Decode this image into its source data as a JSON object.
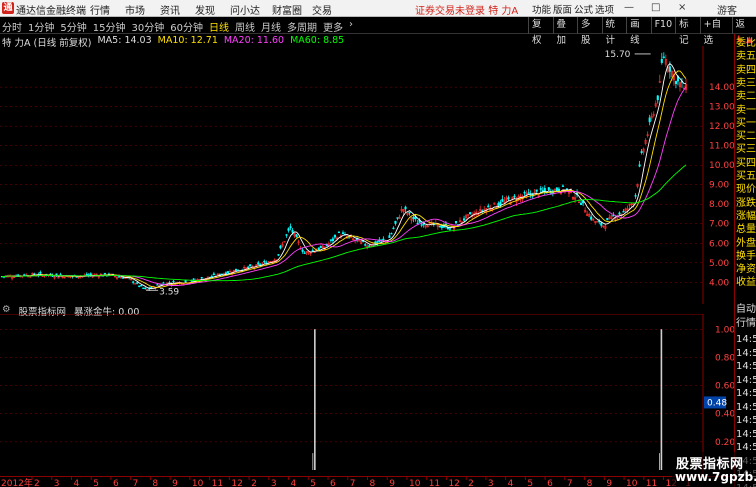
{
  "app": {
    "title": "通达信金融终端",
    "menu": [
      "行情",
      "市场",
      "资讯",
      "发现",
      "问小达",
      "财富圈",
      "交易"
    ],
    "status": "证券交易未登录",
    "stock_name": "特 力A",
    "right_menu": [
      "功能",
      "版面",
      "公式",
      "选项"
    ],
    "guest": "游客",
    "window_buttons": [
      "—",
      "□",
      "×"
    ]
  },
  "toolbar": {
    "periods": [
      "分时",
      "1分钟",
      "5分钟",
      "15分钟",
      "30分钟",
      "60分钟",
      "日线",
      "周线",
      "月线",
      "多周期",
      "更多"
    ],
    "active_period": "日线",
    "more_arrow": "›",
    "tools": [
      "复权",
      "叠加",
      "多股",
      "统计",
      "画线",
      "F10",
      "标记",
      "+自选",
      "返回"
    ]
  },
  "legend": {
    "stock": "特 力A (日线 前复权)",
    "ma5": "MA5: 14.03",
    "ma10": "MA10: 12.71",
    "ma20": "MA20: 11.60",
    "ma60": "MA60: 8.85"
  },
  "colors": {
    "up": "#ff3030",
    "down": "#00ffff",
    "ma5": "#ffffff",
    "ma10": "#ffe000",
    "ma20": "#ff40ff",
    "ma60": "#00ff00",
    "grid": "#8b0000",
    "axis_text": "#ff4040",
    "ind_bar": "#d0d0d0",
    "ind_marker": "#0044aa"
  },
  "chart_data": [
    {
      "type": "candlestick",
      "title": "特 力A (日线 前复权)",
      "y_ticks": [
        14.0,
        13.0,
        12.0,
        11.0,
        10.0,
        9.0,
        8.0,
        7.0,
        6.0,
        5.0,
        4.0
      ],
      "ylim": [
        3.4,
        15.8
      ],
      "annotations": [
        {
          "label": "15.70",
          "x": 0.917,
          "y": 15.7
        },
        {
          "label": "3.59",
          "x": 0.205,
          "y": 3.59
        }
      ],
      "series": [
        {
          "name": "MA5",
          "last": 14.03
        },
        {
          "name": "MA10",
          "last": 12.71
        },
        {
          "name": "MA20",
          "last": 11.6
        },
        {
          "name": "MA60",
          "last": 8.85
        }
      ],
      "price_path": [
        [
          0.0,
          4.3
        ],
        [
          0.05,
          4.4
        ],
        [
          0.1,
          4.3
        ],
        [
          0.15,
          4.4
        ],
        [
          0.18,
          4.2
        ],
        [
          0.205,
          3.6
        ],
        [
          0.23,
          3.95
        ],
        [
          0.26,
          4.0
        ],
        [
          0.3,
          4.3
        ],
        [
          0.33,
          4.6
        ],
        [
          0.36,
          4.8
        ],
        [
          0.39,
          5.2
        ],
        [
          0.41,
          6.8
        ],
        [
          0.43,
          5.5
        ],
        [
          0.46,
          5.8
        ],
        [
          0.48,
          6.5
        ],
        [
          0.5,
          6.2
        ],
        [
          0.52,
          5.9
        ],
        [
          0.55,
          6.2
        ],
        [
          0.57,
          7.8
        ],
        [
          0.59,
          7.1
        ],
        [
          0.62,
          6.9
        ],
        [
          0.64,
          6.8
        ],
        [
          0.66,
          7.3
        ],
        [
          0.69,
          7.8
        ],
        [
          0.72,
          8.2
        ],
        [
          0.75,
          8.5
        ],
        [
          0.78,
          8.7
        ],
        [
          0.8,
          8.8
        ],
        [
          0.82,
          8.3
        ],
        [
          0.84,
          7.2
        ],
        [
          0.855,
          6.9
        ],
        [
          0.87,
          7.4
        ],
        [
          0.885,
          7.6
        ],
        [
          0.9,
          8.2
        ],
        [
          0.91,
          10.5
        ],
        [
          0.925,
          12.5
        ],
        [
          0.935,
          13.8
        ],
        [
          0.94,
          15.7
        ],
        [
          0.96,
          14.3
        ],
        [
          0.973,
          13.9
        ]
      ]
    },
    {
      "type": "bar",
      "title": "股票指标网 暴涨金牛: 0.00",
      "y_ticks": [
        1.0,
        0.8,
        0.6,
        0.4,
        0.2
      ],
      "ylim": [
        0.0,
        1.08
      ],
      "marker": 0.48,
      "spikes": [
        {
          "x": 0.445,
          "value": 1.0
        },
        {
          "x": 0.938,
          "value": 1.0
        }
      ]
    }
  ],
  "indicator": {
    "icon": "⚙",
    "source": "股票指标网",
    "label": "暴涨金牛: 0.00"
  },
  "date_axis": {
    "year": "2012年",
    "months": [
      "2",
      "3",
      "4",
      "5",
      "6",
      "7",
      "8",
      "9",
      "10",
      "11",
      "12",
      "2",
      "3",
      "4",
      "5",
      "6",
      "7",
      "8",
      "9",
      "10",
      "11",
      "12",
      "2",
      "3",
      "4",
      "5",
      "6",
      "7",
      "8",
      "9",
      "10",
      "11",
      "12",
      "1"
    ]
  },
  "sidebar": {
    "tag": "L ▲",
    "items": [
      "委比",
      "卖五",
      "卖四",
      "卖三",
      "卖二",
      "卖一",
      "买一",
      "买二",
      "买三",
      "买四",
      "买五",
      "现价",
      "涨跌",
      "涨幅",
      "总量",
      "外盘",
      "换手",
      "净资",
      "收益"
    ],
    "section": "自动",
    "section2": "行情",
    "times": [
      "14:5",
      "14:5",
      "14:5",
      "14:5",
      "14:5",
      "14:5",
      "14:5",
      "14:5",
      "14:5",
      "14:5",
      "14:5",
      "14:5"
    ]
  },
  "watermark": {
    "line1": "股票指标网",
    "line2": "www.7gpzb.com"
  }
}
